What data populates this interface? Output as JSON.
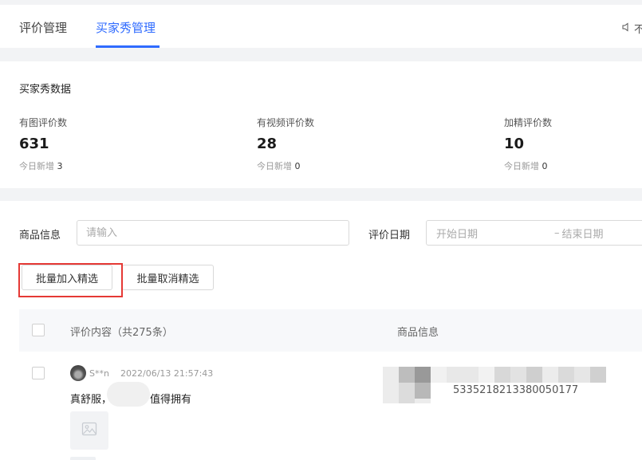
{
  "tabs": [
    {
      "label": "评价管理",
      "active": false
    },
    {
      "label": "买家秀管理",
      "active": true
    }
  ],
  "notice": {
    "text": "不"
  },
  "stats": {
    "title": "买家秀数据",
    "items": [
      {
        "label": "有图评价数",
        "value": "631",
        "today_label": "今日新增",
        "today_value": "3"
      },
      {
        "label": "有视频评价数",
        "value": "28",
        "today_label": "今日新增",
        "today_value": "0"
      },
      {
        "label": "加精评价数",
        "value": "10",
        "today_label": "今日新增",
        "today_value": "0"
      }
    ]
  },
  "filters": {
    "product_label": "商品信息",
    "product_placeholder": "请输入",
    "date_label": "评价日期",
    "date_start": "开始日期",
    "date_sep": "–",
    "date_end": "结束日期"
  },
  "actions": {
    "batch_add": "批量加入精选",
    "batch_remove": "批量取消精选"
  },
  "table": {
    "columns": [
      "评价内容（共275条）",
      "商品信息"
    ],
    "rows": [
      {
        "user": "S**n",
        "time": "2022/06/13 21:57:43",
        "text_before": "真舒服，",
        "text_after": "值得拥有",
        "product_id": "5335218213380050177"
      }
    ]
  },
  "colors": {
    "accent": "#2f6bff",
    "highlight": "#e53935"
  }
}
